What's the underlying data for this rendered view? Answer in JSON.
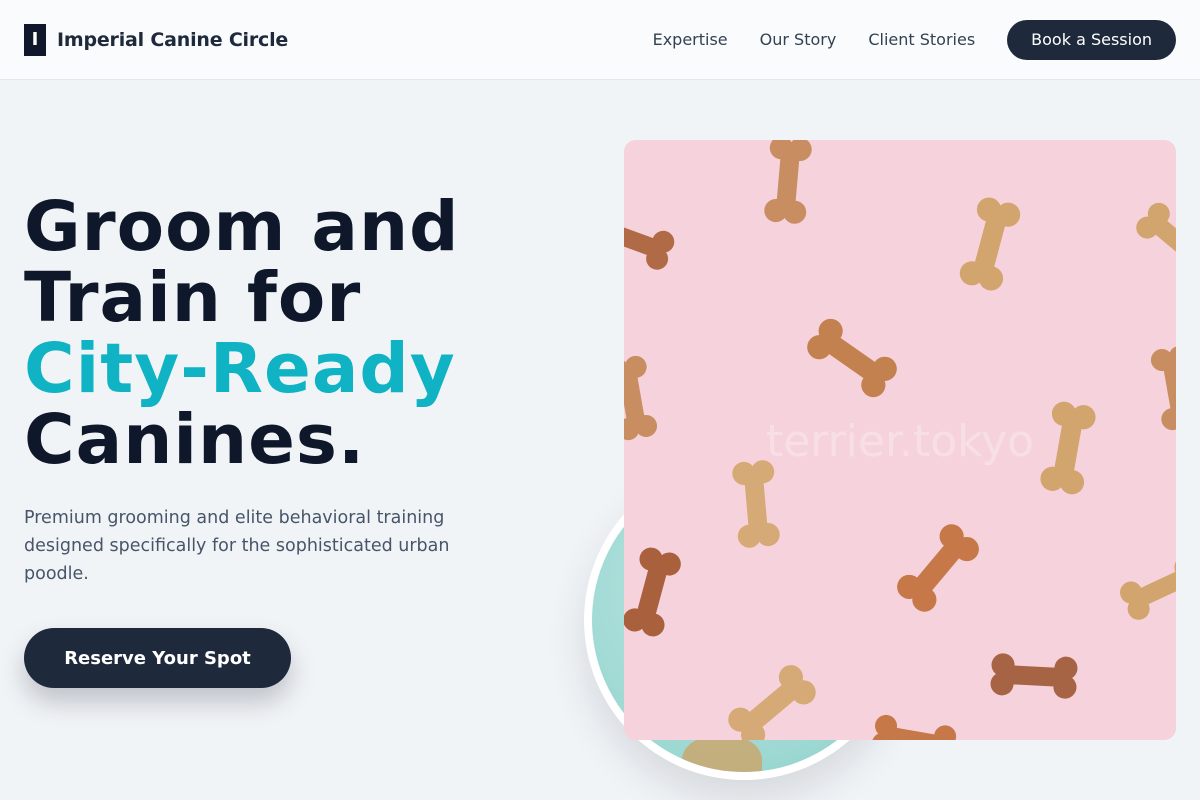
{
  "header": {
    "brand_mark": "I",
    "brand_name": "Imperial Canine Circle",
    "nav": [
      "Expertise",
      "Our Story",
      "Client Stories"
    ],
    "book_label": "Book a Session"
  },
  "hero": {
    "title_lines": [
      "Groom and",
      "Train for"
    ],
    "title_accent": "City-Ready",
    "title_last": "Canines.",
    "subtitle": "Premium grooming and elite behavioral training designed specifically for the sophisticated urban poodle.",
    "cta_label": "Reserve Your Spot"
  },
  "media": {
    "watermark": "terrier.tokyo",
    "photo_icon": "dog-biscuits-photo",
    "circle_icon": "dog-photo"
  },
  "colors": {
    "accent": "#0fb3c3",
    "primary": "#1e293b",
    "background": "#f1f4f7",
    "photo_bg": "#f6d3dc"
  }
}
